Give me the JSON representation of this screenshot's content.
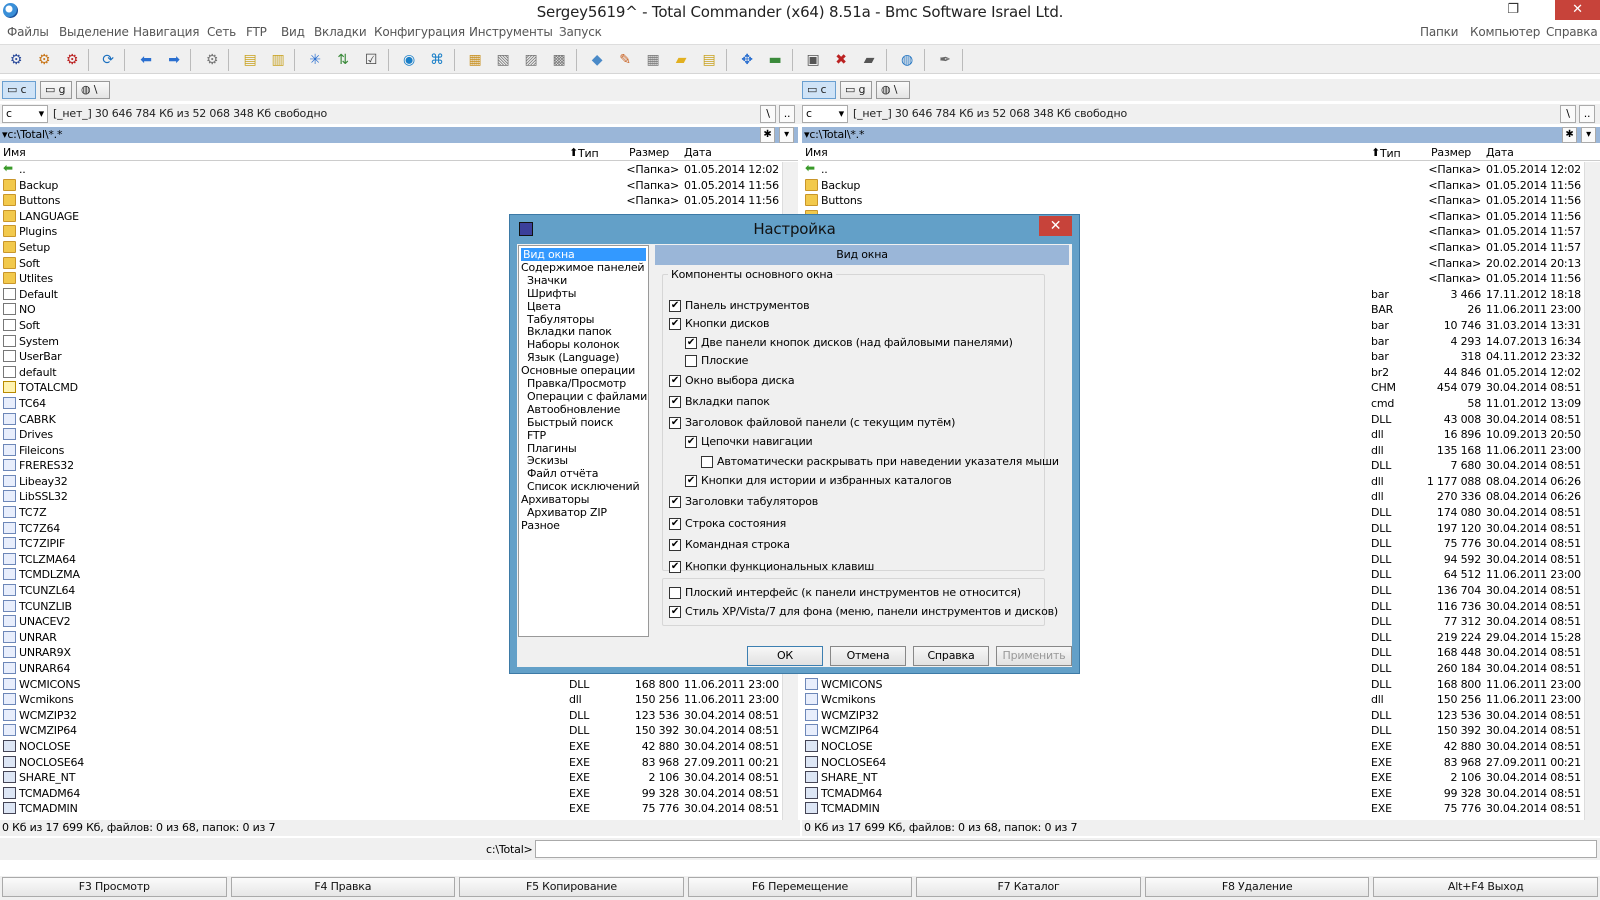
{
  "window": {
    "title": "Sergey5619^ - Total Commander (x64) 8.51a - Bmc Software Israel Ltd."
  },
  "menu": {
    "left": [
      "Файлы",
      "Выделение",
      "Навигация",
      "Сеть",
      "FTP",
      "Вид",
      "Вкладки",
      "Конфигурация",
      "Инструменты",
      "Запуск"
    ],
    "right": [
      "Папки",
      "Компьютер",
      "Справка"
    ]
  },
  "drives": {
    "c": "c",
    "g": "g",
    "net": "\\"
  },
  "left_panel": {
    "drive_select": "c",
    "disk_info": "[_нет_]  30 646 784 Кб из 52 068 348 Кб свободно",
    "path": "c:\\Total\\*.*",
    "headers": {
      "name": "Имя",
      "type": "Тип",
      "size": "Размер",
      "date": "Дата"
    },
    "status": "0 Кб из 17 699 Кб, файлов: 0 из 68, папок: 0 из 7",
    "rows": [
      {
        "icon": "up",
        "name": "..",
        "type": "",
        "size": "<Папка>",
        "date": "01.05.2014 12:02"
      },
      {
        "icon": "folder",
        "name": "Backup",
        "type": "",
        "size": "<Папка>",
        "date": "01.05.2014 11:56"
      },
      {
        "icon": "folder",
        "name": "Buttons",
        "type": "",
        "size": "<Папка>",
        "date": "01.05.2014 11:56"
      },
      {
        "icon": "folder",
        "name": "LANGUAGE",
        "type": "",
        "size": "",
        "date": ""
      },
      {
        "icon": "folder",
        "name": "Plugins",
        "type": "",
        "size": "",
        "date": ""
      },
      {
        "icon": "folder",
        "name": "Setup",
        "type": "",
        "size": "",
        "date": ""
      },
      {
        "icon": "folder",
        "name": "Soft",
        "type": "",
        "size": "",
        "date": ""
      },
      {
        "icon": "folder",
        "name": "Utlites",
        "type": "",
        "size": "",
        "date": ""
      },
      {
        "icon": "file",
        "name": "Default",
        "type": "",
        "size": "",
        "date": ""
      },
      {
        "icon": "file",
        "name": "NO",
        "type": "",
        "size": "",
        "date": ""
      },
      {
        "icon": "file",
        "name": "Soft",
        "type": "",
        "size": "",
        "date": ""
      },
      {
        "icon": "file",
        "name": "System",
        "type": "",
        "size": "",
        "date": ""
      },
      {
        "icon": "file",
        "name": "UserBar",
        "type": "",
        "size": "",
        "date": ""
      },
      {
        "icon": "file",
        "name": "default",
        "type": "",
        "size": "",
        "date": ""
      },
      {
        "icon": "cfg",
        "name": "TOTALCMD",
        "type": "",
        "size": "",
        "date": ""
      },
      {
        "icon": "dll",
        "name": "TC64",
        "type": "",
        "size": "",
        "date": ""
      },
      {
        "icon": "dll",
        "name": "CABRK",
        "type": "",
        "size": "",
        "date": ""
      },
      {
        "icon": "dll",
        "name": "Drives",
        "type": "",
        "size": "",
        "date": ""
      },
      {
        "icon": "dll",
        "name": "Fileicons",
        "type": "",
        "size": "",
        "date": ""
      },
      {
        "icon": "dll",
        "name": "FRERES32",
        "type": "",
        "size": "",
        "date": ""
      },
      {
        "icon": "dll",
        "name": "Libeay32",
        "type": "",
        "size": "",
        "date": ""
      },
      {
        "icon": "dll",
        "name": "LibSSL32",
        "type": "",
        "size": "",
        "date": ""
      },
      {
        "icon": "dll",
        "name": "TC7Z",
        "type": "",
        "size": "",
        "date": ""
      },
      {
        "icon": "dll",
        "name": "TC7Z64",
        "type": "",
        "size": "",
        "date": ""
      },
      {
        "icon": "dll",
        "name": "TC7ZIPIF",
        "type": "",
        "size": "",
        "date": ""
      },
      {
        "icon": "dll",
        "name": "TCLZMA64",
        "type": "",
        "size": "",
        "date": ""
      },
      {
        "icon": "dll",
        "name": "TCMDLZMA",
        "type": "",
        "size": "",
        "date": ""
      },
      {
        "icon": "dll",
        "name": "TCUNZL64",
        "type": "",
        "size": "",
        "date": ""
      },
      {
        "icon": "dll",
        "name": "TCUNZLIB",
        "type": "",
        "size": "",
        "date": ""
      },
      {
        "icon": "dll",
        "name": "UNACEV2",
        "type": "",
        "size": "",
        "date": ""
      },
      {
        "icon": "dll",
        "name": "UNRAR",
        "type": "",
        "size": "",
        "date": ""
      },
      {
        "icon": "dll",
        "name": "UNRAR9X",
        "type": "",
        "size": "",
        "date": ""
      },
      {
        "icon": "dll",
        "name": "UNRAR64",
        "type": "DLL",
        "size": "260 184",
        "date": "30.04.2014 08:51"
      },
      {
        "icon": "dll",
        "name": "WCMICONS",
        "type": "DLL",
        "size": "168 800",
        "date": "11.06.2011 23:00"
      },
      {
        "icon": "dll",
        "name": "Wcmikons",
        "type": "dll",
        "size": "150 256",
        "date": "11.06.2011 23:00"
      },
      {
        "icon": "dll",
        "name": "WCMZIP32",
        "type": "DLL",
        "size": "123 536",
        "date": "30.04.2014 08:51"
      },
      {
        "icon": "dll",
        "name": "WCMZIP64",
        "type": "DLL",
        "size": "150 392",
        "date": "30.04.2014 08:51"
      },
      {
        "icon": "exe",
        "name": "NOCLOSE",
        "type": "EXE",
        "size": "42 880",
        "date": "30.04.2014 08:51"
      },
      {
        "icon": "exe",
        "name": "NOCLOSE64",
        "type": "EXE",
        "size": "83 968",
        "date": "27.09.2011 00:21"
      },
      {
        "icon": "exe",
        "name": "SHARE_NT",
        "type": "EXE",
        "size": "2 106",
        "date": "30.04.2014 08:51"
      },
      {
        "icon": "exe",
        "name": "TCMADM64",
        "type": "EXE",
        "size": "99 328",
        "date": "30.04.2014 08:51"
      },
      {
        "icon": "exe",
        "name": "TCMADMIN",
        "type": "EXE",
        "size": "75 776",
        "date": "30.04.2014 08:51"
      }
    ]
  },
  "right_panel": {
    "drive_select": "c",
    "disk_info": "[_нет_]  30 646 784 Кб из 52 068 348 Кб свободно",
    "path": "c:\\Total\\*.*",
    "headers": {
      "name": "Имя",
      "type": "Тип",
      "size": "Размер",
      "date": "Дата"
    },
    "status": "0 Кб из 17 699 Кб, файлов: 0 из 68, папок: 0 из 7",
    "rows": [
      {
        "icon": "up",
        "name": "..",
        "type": "",
        "size": "<Папка>",
        "date": "01.05.2014 12:02"
      },
      {
        "icon": "folder",
        "name": "Backup",
        "type": "",
        "size": "<Папка>",
        "date": "01.05.2014 11:56"
      },
      {
        "icon": "folder",
        "name": "Buttons",
        "type": "",
        "size": "<Папка>",
        "date": "01.05.2014 11:56"
      },
      {
        "icon": "folder",
        "name": "",
        "type": "",
        "size": "<Папка>",
        "date": "01.05.2014 11:56"
      },
      {
        "icon": "folder",
        "name": "",
        "type": "",
        "size": "<Папка>",
        "date": "01.05.2014 11:57"
      },
      {
        "icon": "folder",
        "name": "",
        "type": "",
        "size": "<Папка>",
        "date": "01.05.2014 11:57"
      },
      {
        "icon": "folder",
        "name": "",
        "type": "",
        "size": "<Папка>",
        "date": "20.02.2014 20:13"
      },
      {
        "icon": "folder",
        "name": "",
        "type": "",
        "size": "<Папка>",
        "date": "01.05.2014 11:56"
      },
      {
        "icon": "file",
        "name": "",
        "type": "bar",
        "size": "3 466",
        "date": "17.11.2012 18:18"
      },
      {
        "icon": "file",
        "name": "",
        "type": "BAR",
        "size": "26",
        "date": "11.06.2011 23:00"
      },
      {
        "icon": "file",
        "name": "",
        "type": "bar",
        "size": "10 746",
        "date": "31.03.2014 13:31"
      },
      {
        "icon": "file",
        "name": "",
        "type": "bar",
        "size": "4 293",
        "date": "14.07.2013 16:34"
      },
      {
        "icon": "file",
        "name": "",
        "type": "bar",
        "size": "318",
        "date": "04.11.2012 23:32"
      },
      {
        "icon": "file",
        "name": "",
        "type": "br2",
        "size": "44 846",
        "date": "01.05.2014 12:02"
      },
      {
        "icon": "cfg",
        "name": "",
        "type": "CHM",
        "size": "454 079",
        "date": "30.04.2014 08:51"
      },
      {
        "icon": "dll",
        "name": "",
        "type": "cmd",
        "size": "58",
        "date": "11.01.2012 13:09"
      },
      {
        "icon": "dll",
        "name": "",
        "type": "DLL",
        "size": "43 008",
        "date": "30.04.2014 08:51"
      },
      {
        "icon": "dll",
        "name": "",
        "type": "dll",
        "size": "16 896",
        "date": "10.09.2013 20:50"
      },
      {
        "icon": "dll",
        "name": "",
        "type": "dll",
        "size": "135 168",
        "date": "11.06.2011 23:00"
      },
      {
        "icon": "dll",
        "name": "",
        "type": "DLL",
        "size": "7 680",
        "date": "30.04.2014 08:51"
      },
      {
        "icon": "dll",
        "name": "",
        "type": "dll",
        "size": "1 177 088",
        "date": "08.04.2014 06:26"
      },
      {
        "icon": "dll",
        "name": "",
        "type": "dll",
        "size": "270 336",
        "date": "08.04.2014 06:26"
      },
      {
        "icon": "dll",
        "name": "",
        "type": "DLL",
        "size": "174 080",
        "date": "30.04.2014 08:51"
      },
      {
        "icon": "dll",
        "name": "",
        "type": "DLL",
        "size": "197 120",
        "date": "30.04.2014 08:51"
      },
      {
        "icon": "dll",
        "name": "",
        "type": "DLL",
        "size": "75 776",
        "date": "30.04.2014 08:51"
      },
      {
        "icon": "dll",
        "name": "",
        "type": "DLL",
        "size": "94 592",
        "date": "30.04.2014 08:51"
      },
      {
        "icon": "dll",
        "name": "",
        "type": "DLL",
        "size": "64 512",
        "date": "11.06.2011 23:00"
      },
      {
        "icon": "dll",
        "name": "",
        "type": "DLL",
        "size": "136 704",
        "date": "30.04.2014 08:51"
      },
      {
        "icon": "dll",
        "name": "",
        "type": "DLL",
        "size": "116 736",
        "date": "30.04.2014 08:51"
      },
      {
        "icon": "dll",
        "name": "",
        "type": "DLL",
        "size": "77 312",
        "date": "30.04.2014 08:51"
      },
      {
        "icon": "dll",
        "name": "",
        "type": "DLL",
        "size": "219 224",
        "date": "29.04.2014 15:28"
      },
      {
        "icon": "dll",
        "name": "",
        "type": "DLL",
        "size": "168 448",
        "date": "30.04.2014 08:51"
      },
      {
        "icon": "dll",
        "name": "UNRAR64",
        "type": "DLL",
        "size": "260 184",
        "date": "30.04.2014 08:51"
      },
      {
        "icon": "dll",
        "name": "WCMICONS",
        "type": "DLL",
        "size": "168 800",
        "date": "11.06.2011 23:00"
      },
      {
        "icon": "dll",
        "name": "Wcmikons",
        "type": "dll",
        "size": "150 256",
        "date": "11.06.2011 23:00"
      },
      {
        "icon": "dll",
        "name": "WCMZIP32",
        "type": "DLL",
        "size": "123 536",
        "date": "30.04.2014 08:51"
      },
      {
        "icon": "dll",
        "name": "WCMZIP64",
        "type": "DLL",
        "size": "150 392",
        "date": "30.04.2014 08:51"
      },
      {
        "icon": "exe",
        "name": "NOCLOSE",
        "type": "EXE",
        "size": "42 880",
        "date": "30.04.2014 08:51"
      },
      {
        "icon": "exe",
        "name": "NOCLOSE64",
        "type": "EXE",
        "size": "83 968",
        "date": "27.09.2011 00:21"
      },
      {
        "icon": "exe",
        "name": "SHARE_NT",
        "type": "EXE",
        "size": "2 106",
        "date": "30.04.2014 08:51"
      },
      {
        "icon": "exe",
        "name": "TCMADM64",
        "type": "EXE",
        "size": "99 328",
        "date": "30.04.2014 08:51"
      },
      {
        "icon": "exe",
        "name": "TCMADMIN",
        "type": "EXE",
        "size": "75 776",
        "date": "30.04.2014 08:51"
      }
    ]
  },
  "cmdline": {
    "label": "c:\\Total>",
    "value": ""
  },
  "fkeys": [
    "F3 Просмотр",
    "F4 Правка",
    "F5 Копирование",
    "F6 Перемещение",
    "F7 Каталог",
    "F8 Удаление",
    "Alt+F4 Выход"
  ],
  "dialog": {
    "title": "Настройка",
    "close": "✕",
    "tree": [
      {
        "label": "Вид окна",
        "level": 0,
        "selected": true
      },
      {
        "label": "Содержимое панелей",
        "level": 0
      },
      {
        "label": "Значки",
        "level": 1
      },
      {
        "label": "Шрифты",
        "level": 1
      },
      {
        "label": "Цвета",
        "level": 1
      },
      {
        "label": "Табуляторы",
        "level": 1
      },
      {
        "label": "Вкладки папок",
        "level": 1
      },
      {
        "label": "Наборы колонок",
        "level": 1
      },
      {
        "label": "Язык (Language)",
        "level": 1
      },
      {
        "label": "Основные операции",
        "level": 0
      },
      {
        "label": "Правка/Просмотр",
        "level": 1
      },
      {
        "label": "Операции с файлами",
        "level": 1
      },
      {
        "label": "Автообновление",
        "level": 1
      },
      {
        "label": "Быстрый поиск",
        "level": 1
      },
      {
        "label": "FTP",
        "level": 1
      },
      {
        "label": "Плагины",
        "level": 1
      },
      {
        "label": "Эскизы",
        "level": 1
      },
      {
        "label": "Файл отчёта",
        "level": 1
      },
      {
        "label": "Список исключений",
        "level": 1
      },
      {
        "label": "Архиваторы",
        "level": 0
      },
      {
        "label": "Архиватор ZIP",
        "level": 1
      },
      {
        "label": "Разное",
        "level": 0
      }
    ],
    "page_header": "Вид окна",
    "group_label": "Компоненты основного окна",
    "options": [
      {
        "label": "Панель инструментов",
        "checked": true,
        "indent": 0
      },
      {
        "label": "Кнопки дисков",
        "checked": true,
        "indent": 0
      },
      {
        "label": "Две панели кнопок дисков (над файловыми панелями)",
        "checked": true,
        "indent": 1
      },
      {
        "label": "Плоские",
        "checked": false,
        "indent": 1
      },
      {
        "label": "Окно выбора диска",
        "checked": true,
        "indent": 0
      },
      {
        "label": "Вкладки папок",
        "checked": true,
        "indent": 0
      },
      {
        "label": "Заголовок файловой панели (с текущим путём)",
        "checked": true,
        "indent": 0
      },
      {
        "label": "Цепочки навигации",
        "checked": true,
        "indent": 1
      },
      {
        "label": "Автоматически раскрывать при наведении указателя мыши",
        "checked": false,
        "indent": 2
      },
      {
        "label": "Кнопки для истории и избранных каталогов",
        "checked": true,
        "indent": 1
      },
      {
        "label": "Заголовки табуляторов",
        "checked": true,
        "indent": 0
      },
      {
        "label": "Строка состояния",
        "checked": true,
        "indent": 0
      },
      {
        "label": "Командная строка",
        "checked": true,
        "indent": 0
      },
      {
        "label": "Кнопки функциональных клавиш",
        "checked": true,
        "indent": 0
      }
    ],
    "options2": [
      {
        "label": "Плоский интерфейс (к панели инструментов не относится)",
        "checked": false
      },
      {
        "label": "Стиль XP/Vista/7 для фона (меню, панели инструментов и дисков)",
        "checked": true
      }
    ],
    "buttons": {
      "ok": "ОК",
      "cancel": "Отмена",
      "help": "Справка",
      "apply": "Применить"
    }
  },
  "colors": {
    "path_bar": "#9ab6d8",
    "dialog_frame": "#63a0c8",
    "selection": "#3399ff",
    "close_red": "#c7433a"
  }
}
